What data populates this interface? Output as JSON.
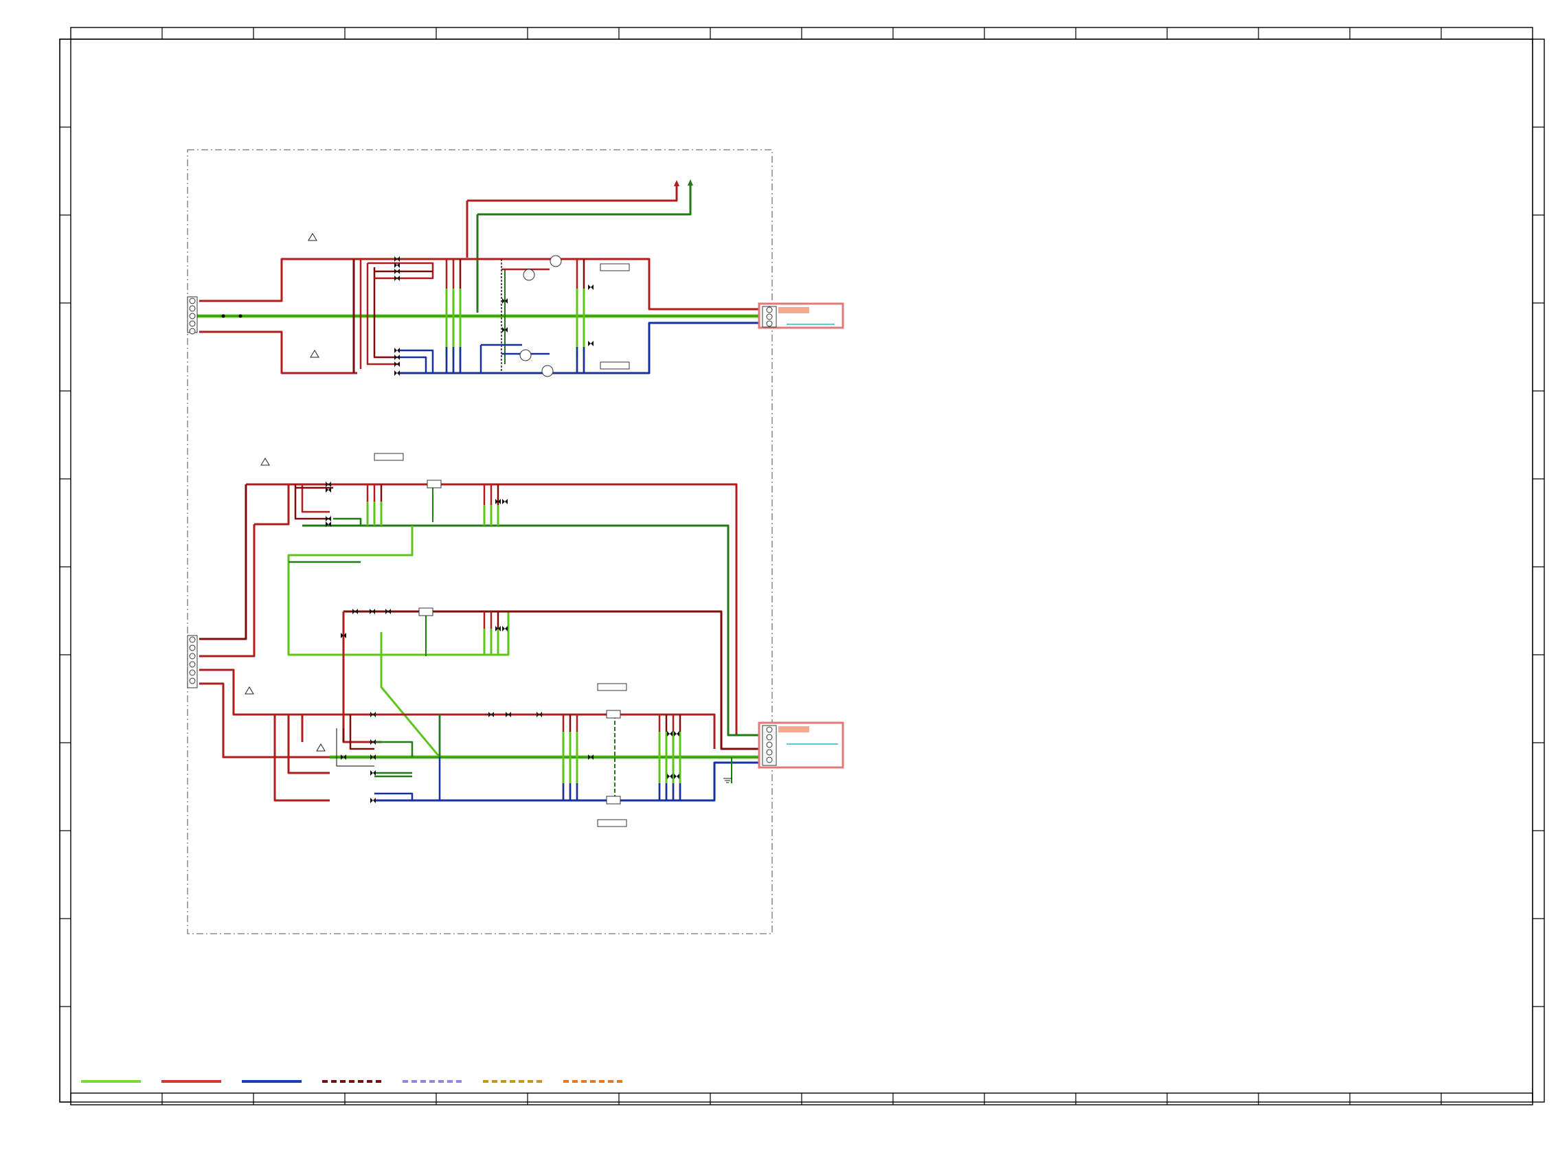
{
  "sheet": {
    "title": "",
    "border_color": "#000000"
  },
  "colors": {
    "green": "#5cc41a",
    "green_dark": "#1f7a12",
    "red": "#b01c1c",
    "red_dark": "#7a0c0c",
    "blue": "#1530a0",
    "blue_dark": "#0a1a6e",
    "connector_fill": "#f5a98e",
    "connector_border": "#e07a7a",
    "connector_line": "#2ab0c8",
    "boundary": "#777777"
  },
  "legend": {
    "items": [
      {
        "name": "green-solid",
        "color": "#7ad93a",
        "style": "solid"
      },
      {
        "name": "red-solid",
        "color": "#d23a2a",
        "style": "solid"
      },
      {
        "name": "blue-solid",
        "color": "#1a3fb0",
        "style": "solid"
      },
      {
        "name": "darkred-dashed",
        "color": "#7a0c0c",
        "style": "dashed"
      },
      {
        "name": "violet-dashed",
        "color": "#8f86e8",
        "style": "dashed"
      },
      {
        "name": "gold-dashed",
        "color": "#c9961a",
        "style": "dashed"
      },
      {
        "name": "orange-dashed",
        "color": "#e8791e",
        "style": "dashed"
      }
    ]
  },
  "icons": {
    "warning": "warning-triangle-icon",
    "valve": "valve-icon",
    "connector": "connector-block-icon",
    "ground": "ground-icon",
    "arrow": "arrow-up-icon"
  }
}
